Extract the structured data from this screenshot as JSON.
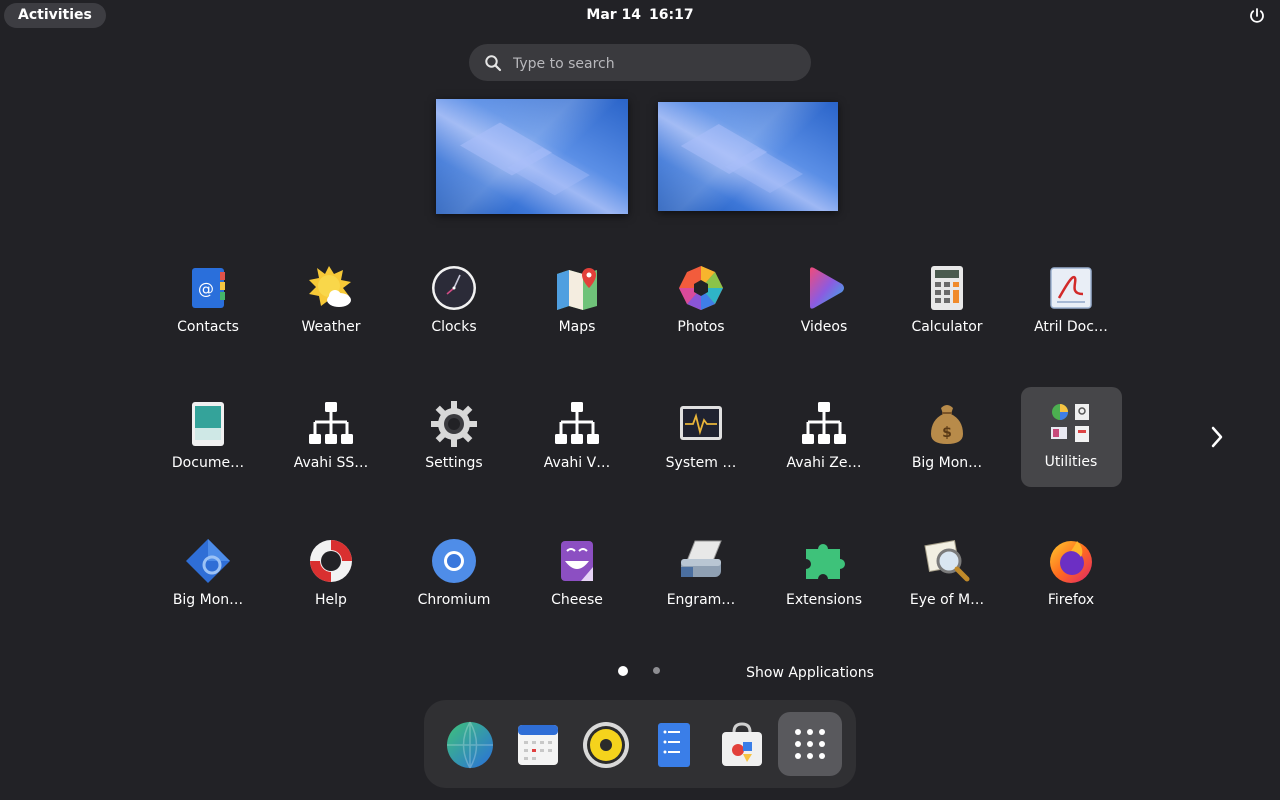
{
  "topbar": {
    "activities_label": "Activities",
    "date": "Mar 14",
    "time": "16:17",
    "power_icon": "power-icon"
  },
  "search": {
    "placeholder": "Type to search",
    "value": ""
  },
  "apps": {
    "row1": [
      {
        "label": "Contacts",
        "icon": "contacts-icon"
      },
      {
        "label": "Weather",
        "icon": "weather-icon"
      },
      {
        "label": "Clocks",
        "icon": "clocks-icon"
      },
      {
        "label": "Maps",
        "icon": "maps-icon"
      },
      {
        "label": "Photos",
        "icon": "photos-icon"
      },
      {
        "label": "Videos",
        "icon": "videos-icon"
      },
      {
        "label": "Calculator",
        "icon": "calculator-icon"
      },
      {
        "label": "Atril Doc…",
        "icon": "atril-icon"
      }
    ],
    "row2": [
      {
        "label": "Docume…",
        "icon": "document-scanner-icon"
      },
      {
        "label": "Avahi SS…",
        "icon": "network-icon"
      },
      {
        "label": "Settings",
        "icon": "settings-gear-icon"
      },
      {
        "label": "Avahi V…",
        "icon": "network-icon"
      },
      {
        "label": "System …",
        "icon": "system-monitor-icon"
      },
      {
        "label": "Avahi Ze…",
        "icon": "network-icon"
      },
      {
        "label": "Big Mon…",
        "icon": "money-bag-icon"
      },
      {
        "label": "Utilities",
        "icon": "folder-icon"
      }
    ],
    "row3": [
      {
        "label": "Big Mon…",
        "icon": "big-money-diamond-icon"
      },
      {
        "label": "Help",
        "icon": "help-lifebuoy-icon"
      },
      {
        "label": "Chromium",
        "icon": "chromium-icon"
      },
      {
        "label": "Cheese",
        "icon": "cheese-icon"
      },
      {
        "label": "Engram…",
        "icon": "engrampa-icon"
      },
      {
        "label": "Extensions",
        "icon": "extensions-puzzle-icon"
      },
      {
        "label": "Eye of M…",
        "icon": "eye-of-mate-icon"
      },
      {
        "label": "Firefox",
        "icon": "firefox-icon"
      }
    ]
  },
  "pagination": {
    "pages": 2,
    "current": 1
  },
  "tooltip": {
    "text": "Show Applications"
  },
  "dash": {
    "items": [
      "web-browser-icon",
      "calendar-icon",
      "rhythmbox-speaker-icon",
      "text-editor-icon",
      "software-store-icon",
      "show-applications-icon"
    ]
  },
  "colors": {
    "background": "#222226",
    "folder_highlight": "#464649",
    "dash_bg": "#303033"
  }
}
